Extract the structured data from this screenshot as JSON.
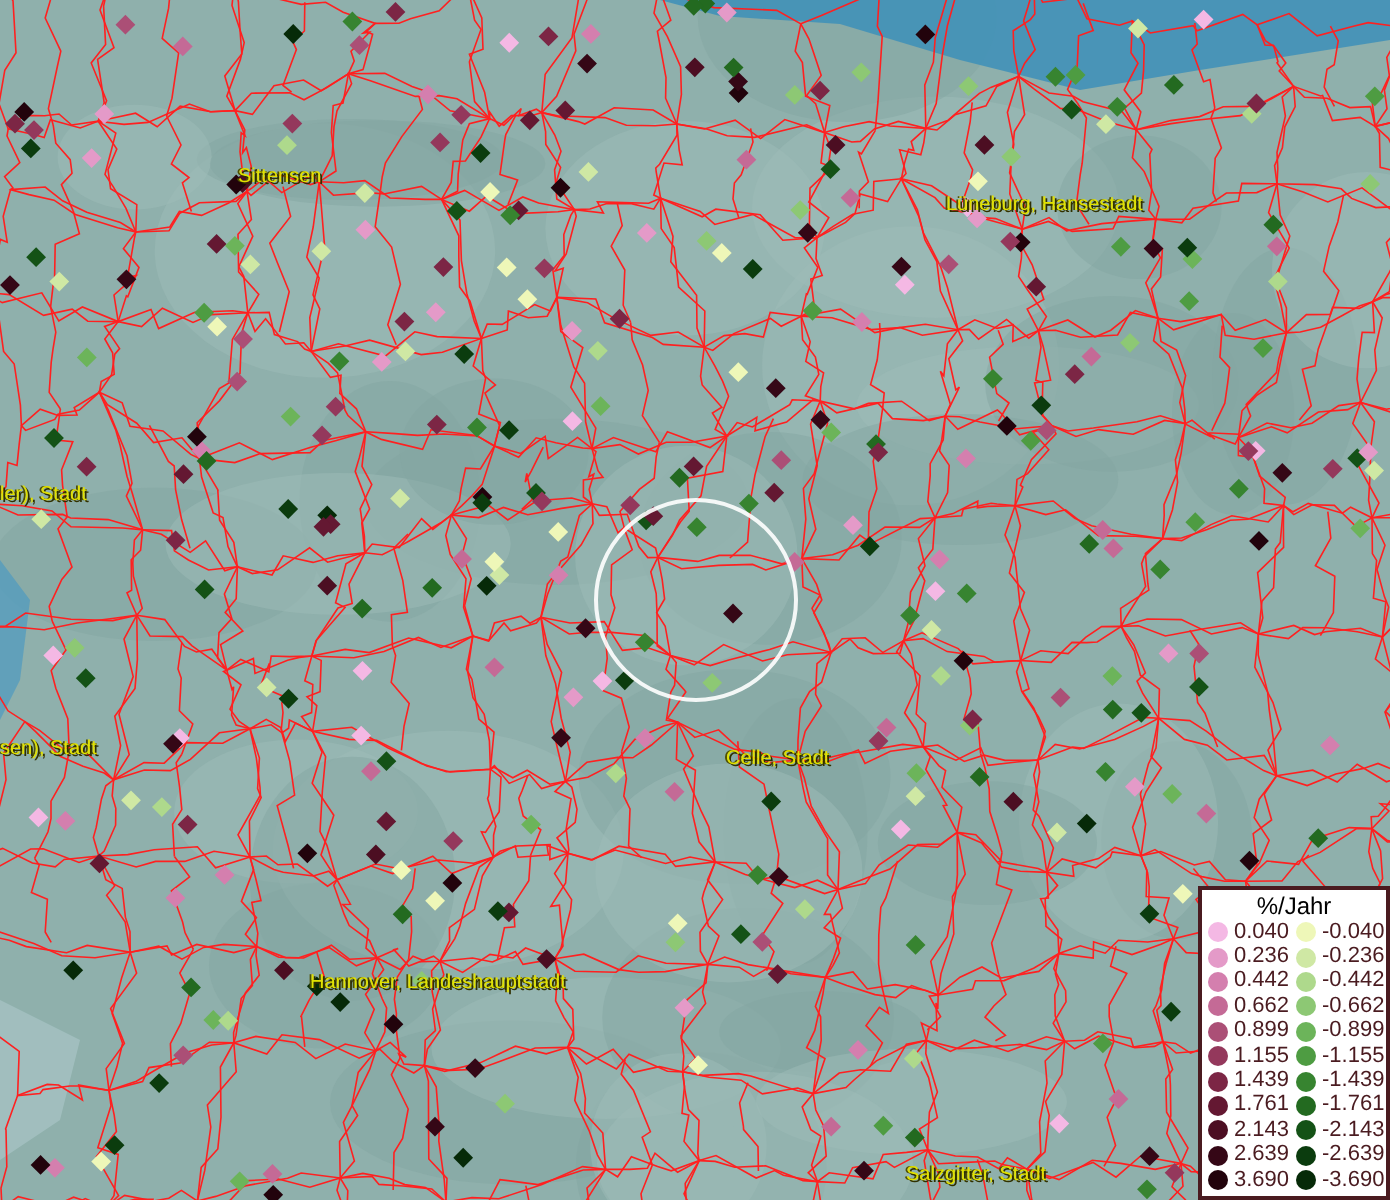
{
  "map": {
    "place_labels": [
      {
        "text": "Sittensen"
      },
      {
        "text": "Lüneburg, Hansestadt"
      },
      {
        "text": "ler), Stadt"
      },
      {
        "text": "sen), Stadt"
      },
      {
        "text": "Celle, Stadt"
      },
      {
        "text": "Hannover, Landeshauptstadt"
      },
      {
        "text": "Salzgitter, Stadt"
      }
    ]
  },
  "legend": {
    "title": "%/Jahr",
    "positive": [
      {
        "value": "0.040",
        "color": "#f4b8e4"
      },
      {
        "value": "0.236",
        "color": "#e49ac8"
      },
      {
        "value": "0.442",
        "color": "#d47fae"
      },
      {
        "value": "0.662",
        "color": "#c46a96"
      },
      {
        "value": "0.899",
        "color": "#ab4f76"
      },
      {
        "value": "1.155",
        "color": "#94385c"
      },
      {
        "value": "1.439",
        "color": "#7c2645"
      },
      {
        "value": "1.761",
        "color": "#641832"
      },
      {
        "value": "2.143",
        "color": "#4c0e22"
      },
      {
        "value": "2.639",
        "color": "#350716"
      },
      {
        "value": "3.690",
        "color": "#22030c"
      }
    ],
    "negative": [
      {
        "value": "-0.040",
        "color": "#eef7b8"
      },
      {
        "value": "-0.236",
        "color": "#cfe8a4"
      },
      {
        "value": "-0.442",
        "color": "#aed98c"
      },
      {
        "value": "-0.662",
        "color": "#8dc874"
      },
      {
        "value": "-0.899",
        "color": "#6cb45a"
      },
      {
        "value": "-1.155",
        "color": "#4e9c42"
      },
      {
        "value": "-1.439",
        "color": "#378430"
      },
      {
        "value": "-1.761",
        "color": "#236a20"
      },
      {
        "value": "-2.143",
        "color": "#145216"
      },
      {
        "value": "-2.639",
        "color": "#0b3c0e"
      },
      {
        "value": "-3.690",
        "color": "#062a08"
      }
    ]
  }
}
